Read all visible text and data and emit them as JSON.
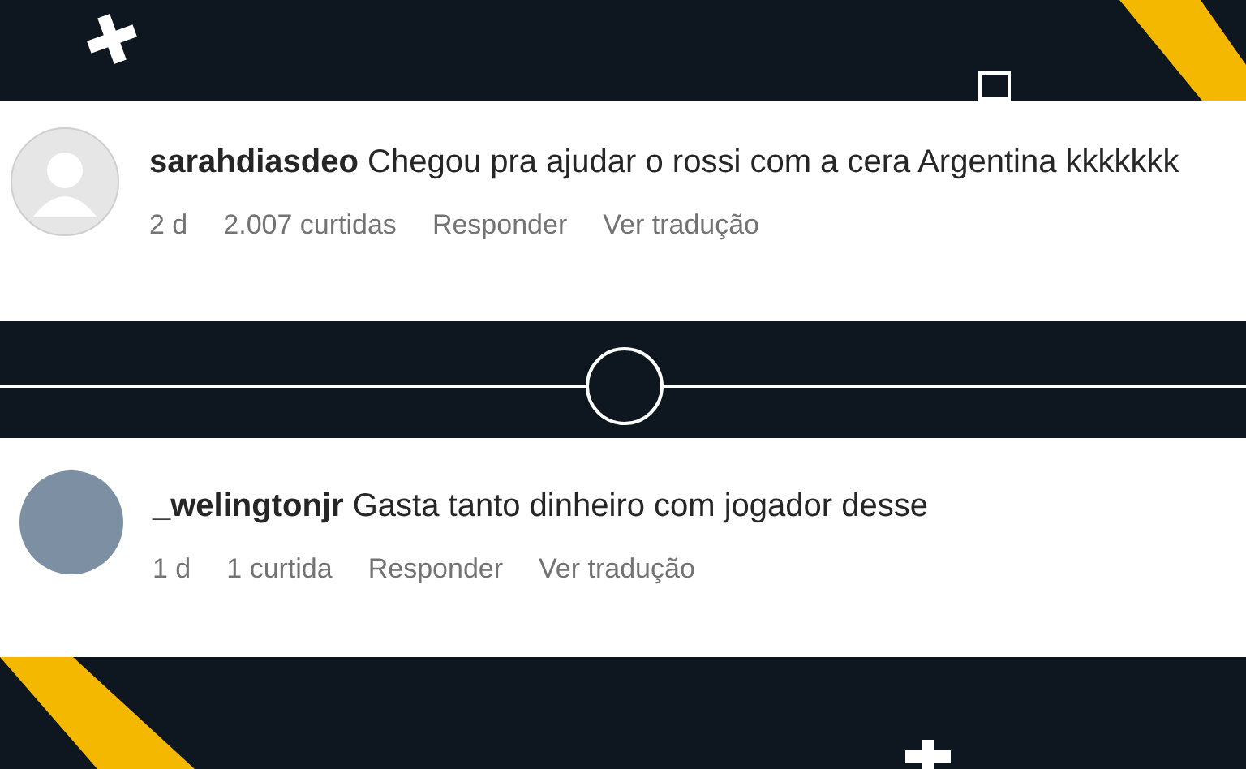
{
  "comments": [
    {
      "kind": "default",
      "username": "sarahdiasdeo",
      "text": "Chegou pra ajudar o rossi com a cera Argentina kkkkkkk",
      "time": "2 d",
      "likes": "2.007 curtidas",
      "reply": "Responder",
      "translate": "Ver tradução"
    },
    {
      "kind": "photo",
      "username": "_welingtonjr",
      "text": "Gasta tanto dinheiro com jogador desse",
      "time": "1 d",
      "likes": "1 curtida",
      "reply": "Responder",
      "translate": "Ver tradução"
    }
  ]
}
